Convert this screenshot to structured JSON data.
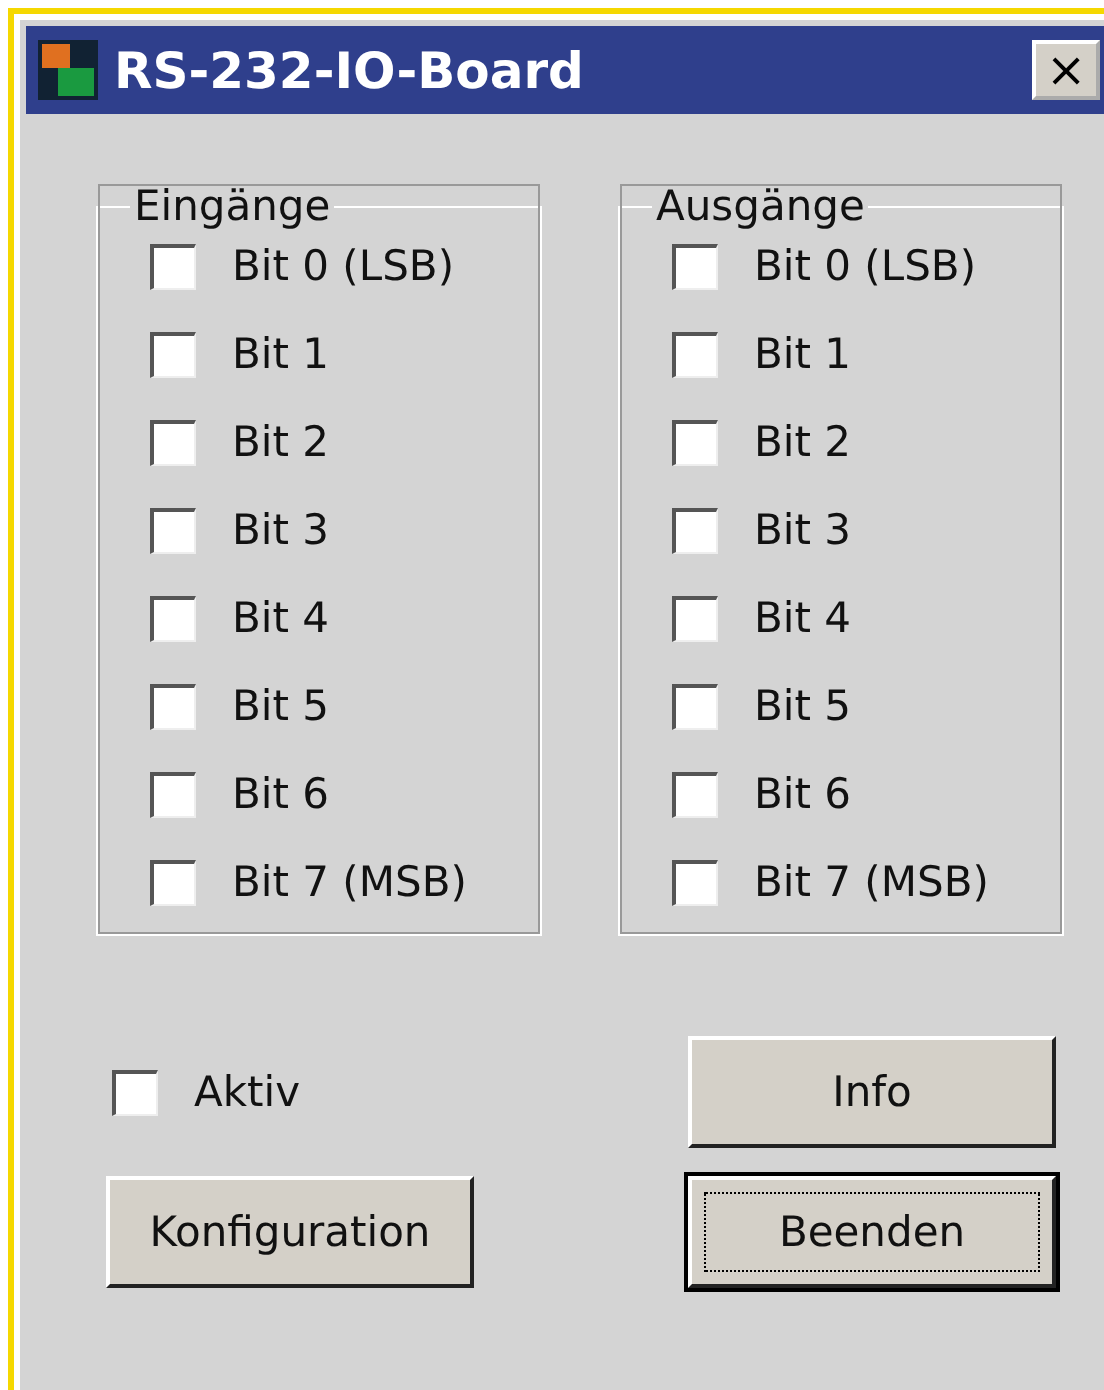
{
  "window": {
    "title": "RS-232-IO-Board",
    "close": "×"
  },
  "groups": [
    {
      "title": "Eingänge",
      "bits": [
        {
          "label": "Bit 0 (LSB)",
          "checked": false
        },
        {
          "label": "Bit 1",
          "checked": false
        },
        {
          "label": "Bit 2",
          "checked": false
        },
        {
          "label": "Bit 3",
          "checked": false
        },
        {
          "label": "Bit 4",
          "checked": false
        },
        {
          "label": "Bit 5",
          "checked": false
        },
        {
          "label": "Bit 6",
          "checked": false
        },
        {
          "label": "Bit 7 (MSB)",
          "checked": false
        }
      ]
    },
    {
      "title": "Ausgänge",
      "bits": [
        {
          "label": "Bit 0 (LSB)",
          "checked": false
        },
        {
          "label": "Bit 1",
          "checked": false
        },
        {
          "label": "Bit 2",
          "checked": false
        },
        {
          "label": "Bit 3",
          "checked": false
        },
        {
          "label": "Bit 4",
          "checked": false
        },
        {
          "label": "Bit 5",
          "checked": false
        },
        {
          "label": "Bit 6",
          "checked": false
        },
        {
          "label": "Bit 7 (MSB)",
          "checked": false
        }
      ]
    }
  ],
  "active": {
    "label": "Aktiv",
    "checked": false
  },
  "buttons": [
    {
      "label": "Info",
      "focused": false
    },
    {
      "label": "Konfiguration",
      "focused": false
    },
    {
      "label": "Beenden",
      "focused": true
    }
  ]
}
